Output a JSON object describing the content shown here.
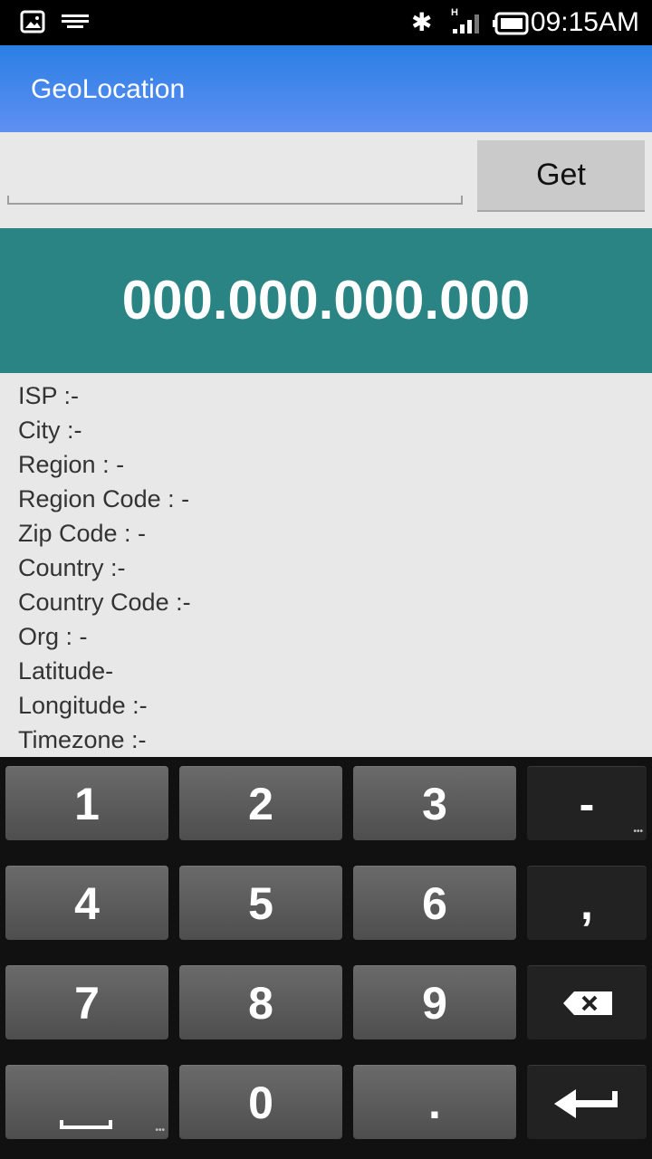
{
  "status_bar": {
    "time": "09:15AM",
    "icons": [
      "image-icon",
      "keyboard-icon",
      "bluetooth-icon",
      "signal-icon",
      "battery-icon"
    ],
    "network": "H"
  },
  "app_bar": {
    "title": "GeoLocation",
    "color": "#2a7fe4"
  },
  "lookup": {
    "input_value": "",
    "get_label": "Get"
  },
  "ip_display": {
    "value": "000.000.000.000",
    "color": "#2a8484"
  },
  "info": [
    "ISP :-",
    "City :-",
    "Region : -",
    "Region Code : -",
    "Zip Code : -",
    "Country :-",
    "Country Code :-",
    "Org : -",
    "Latitude-",
    "Longitude :-",
    "Timezone :-"
  ],
  "keyboard": {
    "keys": [
      "1",
      "2",
      "3",
      "-",
      "4",
      "5",
      "6",
      ",",
      "7",
      "8",
      "9",
      "backspace",
      "space",
      "0",
      ".",
      "enter"
    ]
  }
}
